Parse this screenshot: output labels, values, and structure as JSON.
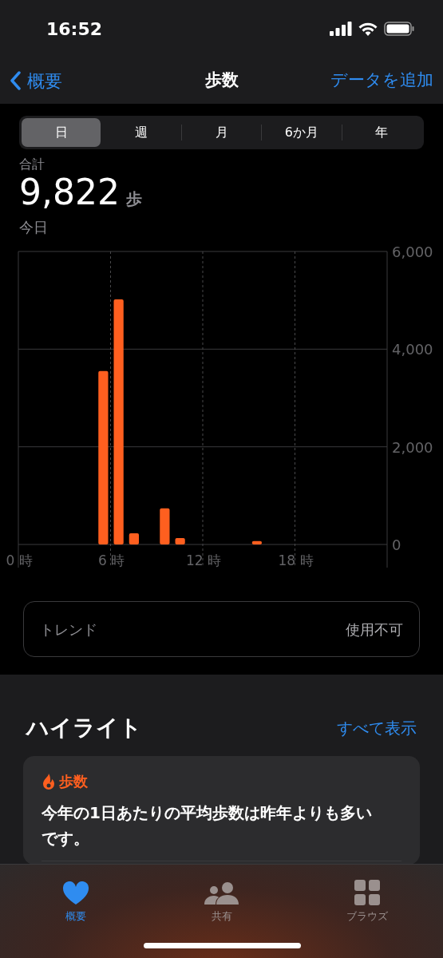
{
  "status_bar": {
    "time": "16:52"
  },
  "nav": {
    "back": "概要",
    "title": "歩数",
    "action": "データを追加"
  },
  "segments": [
    {
      "label": "日",
      "selected": true
    },
    {
      "label": "週",
      "selected": false
    },
    {
      "label": "月",
      "selected": false
    },
    {
      "label": "6か月",
      "selected": false
    },
    {
      "label": "年",
      "selected": false
    }
  ],
  "summary": {
    "label": "合計",
    "value": "9,822",
    "unit": "歩",
    "date": "今日"
  },
  "chart_data": {
    "type": "bar",
    "x": [
      5.5,
      6.5,
      7.5,
      9.5,
      10.5,
      15.5
    ],
    "series": [
      {
        "color": "#ff5f1f",
        "values": [
          3550,
          5020,
          230,
          740,
          130,
          70
        ]
      }
    ],
    "grid": true,
    "xlim": [
      0,
      24
    ],
    "ylim": [
      0,
      6000
    ],
    "yticks": [
      0,
      {
        "value": 2000,
        "label": "2,000"
      },
      {
        "value": 4000,
        "label": "4,000"
      },
      {
        "value": 6000,
        "label": "6,000"
      }
    ],
    "xticks": [
      {
        "value": 0,
        "label": "0 時"
      },
      {
        "value": 6,
        "label": "6 時"
      },
      {
        "value": 12,
        "label": "12 時"
      },
      {
        "value": 18,
        "label": "18 時"
      }
    ]
  },
  "trend": {
    "label": "トレンド",
    "value": "使用不可"
  },
  "highlights": {
    "title": "ハイライト",
    "see_all": "すべて表示",
    "card": {
      "category": "歩数",
      "text": "今年の1日あたりの平均歩数は昨年よりも多いです。"
    }
  },
  "tab_bar": [
    {
      "label": "概要",
      "selected": true
    },
    {
      "label": "共有",
      "selected": false
    },
    {
      "label": "ブラウズ",
      "selected": false
    }
  ]
}
